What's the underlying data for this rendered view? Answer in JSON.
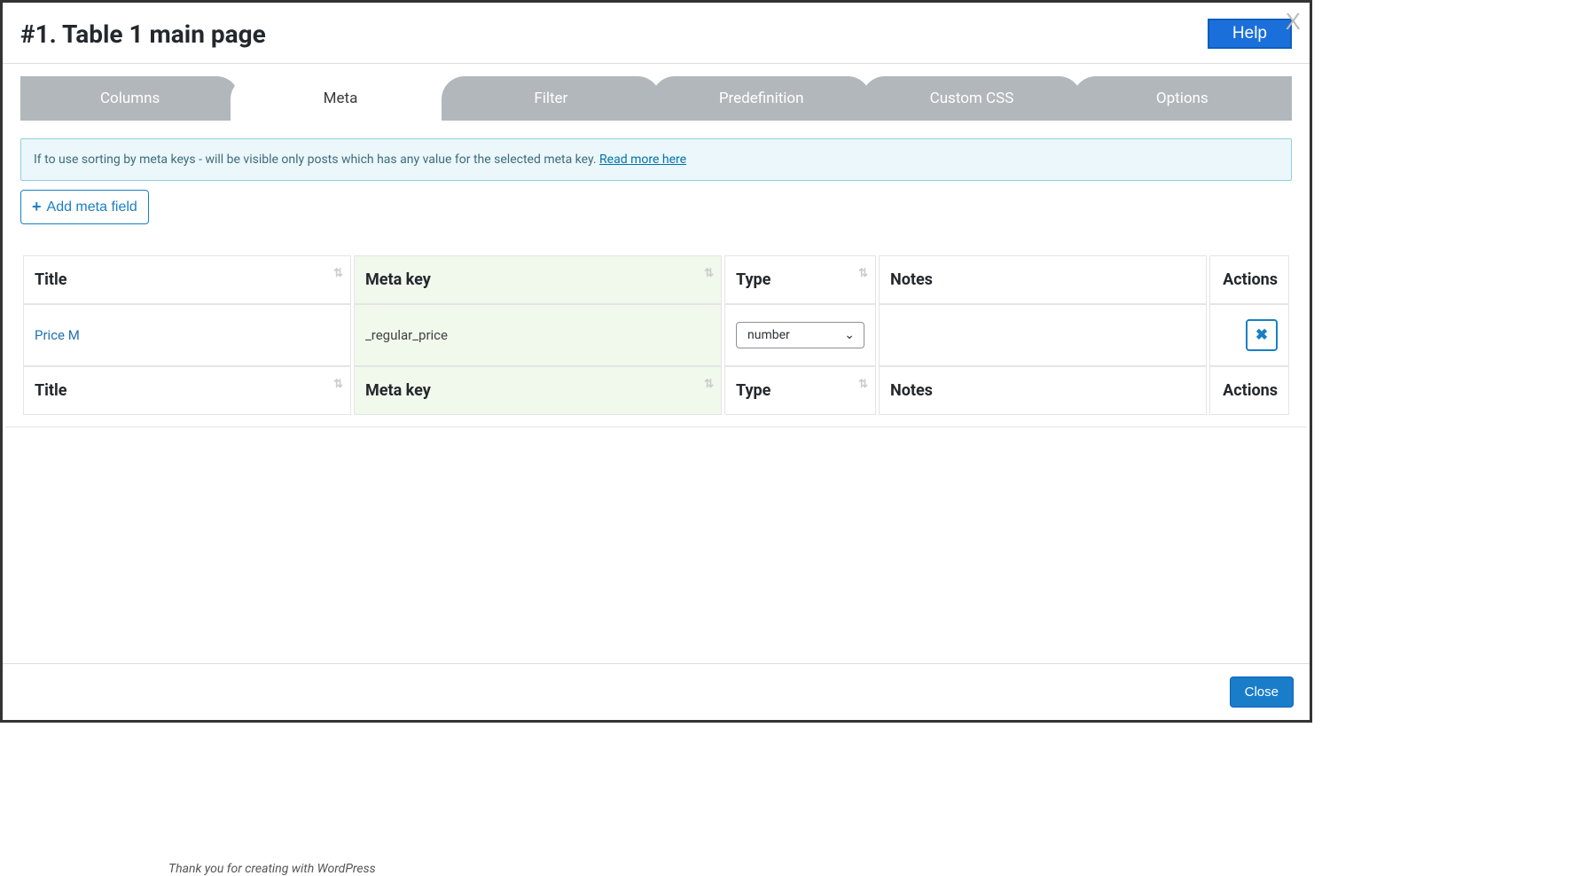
{
  "header": {
    "title": "#1. Table 1 main page",
    "help_label": "Help",
    "close_x": "X"
  },
  "tabs": {
    "columns": "Columns",
    "meta": "Meta",
    "filter": "Filter",
    "predefinition": "Predefinition",
    "custom_css": "Custom CSS",
    "options": "Options"
  },
  "alert": {
    "text": "If to use sorting by meta keys - will be visible only posts which has any value for the selected meta key. ",
    "link": "Read more here"
  },
  "buttons": {
    "add_meta": "Add meta field",
    "close": "Close"
  },
  "table": {
    "headers": {
      "title": "Title",
      "meta_key": "Meta key",
      "type": "Type",
      "notes": "Notes",
      "actions": "Actions"
    },
    "rows": [
      {
        "title": "Price M",
        "meta_key": "_regular_price",
        "type": "number",
        "notes": ""
      }
    ]
  },
  "behind": "Thank you for creating with WordPress"
}
